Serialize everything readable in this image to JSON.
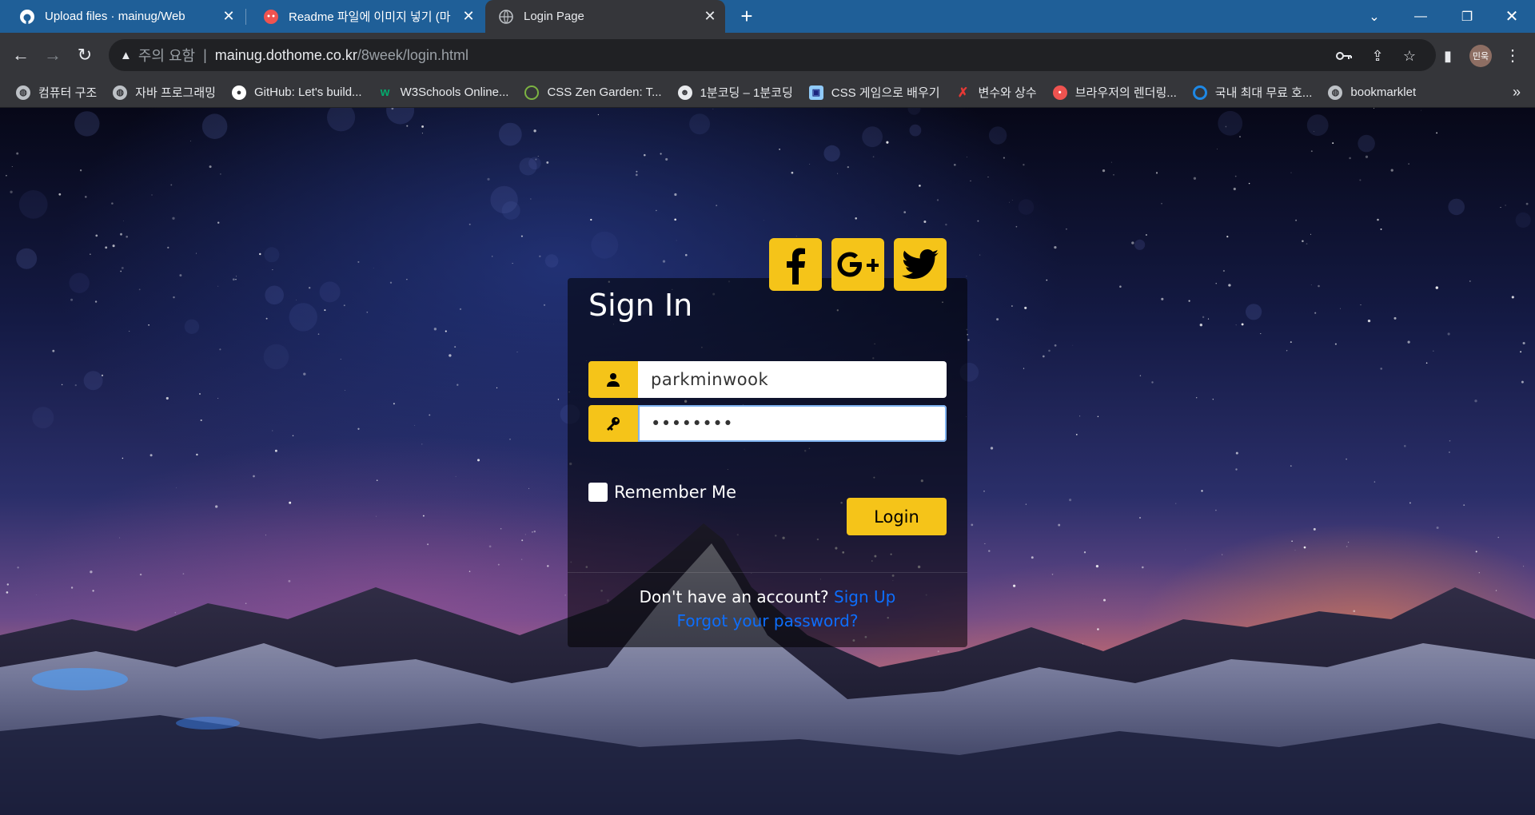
{
  "browser": {
    "tabs": [
      {
        "title": "Upload files · mainug/Web",
        "icon": "github-icon"
      },
      {
        "title": "Readme 파일에 이미지 넣기 (마",
        "icon": "readme-icon"
      },
      {
        "title": "Login Page",
        "icon": "globe-icon"
      }
    ],
    "new_tab": "+",
    "address": {
      "security_label": "주의 요함",
      "host": "mainug.dothome.co.kr",
      "path": "/8week/login.html"
    },
    "profile_initials": "민욱",
    "bookmarks": [
      {
        "label": "컴퓨터 구조",
        "icon": "globe-icon"
      },
      {
        "label": "자바 프로그래밍",
        "icon": "globe-icon"
      },
      {
        "label": "GitHub: Let's build...",
        "icon": "github-icon"
      },
      {
        "label": "W3Schools Online...",
        "icon": "w3schools-icon"
      },
      {
        "label": "CSS Zen Garden: T...",
        "icon": "zen-garden-icon"
      },
      {
        "label": "1분코딩 – 1분코딩",
        "icon": "skull-icon"
      },
      {
        "label": "CSS 게임으로 배우기",
        "icon": "game-icon"
      },
      {
        "label": "변수와 상수",
        "icon": "x-icon"
      },
      {
        "label": "브라우저의 렌더링...",
        "icon": "readme-icon"
      },
      {
        "label": "국내 최대 무료 호...",
        "icon": "spiral-icon"
      },
      {
        "label": "bookmarklet",
        "icon": "globe-icon"
      }
    ],
    "bookmarks_more": "»"
  },
  "login": {
    "title": "Sign In",
    "username_value": "parkminwook",
    "password_value": "••••••••",
    "remember_label": "Remember Me",
    "login_button": "Login",
    "no_account_text": "Don't have an account?",
    "signup_link": "Sign Up",
    "forgot_link": "Forgot your password?",
    "social": [
      "facebook-icon",
      "google-plus-icon",
      "twitter-icon"
    ],
    "accent_color": "#f5c419",
    "link_color": "#0d6efd"
  }
}
